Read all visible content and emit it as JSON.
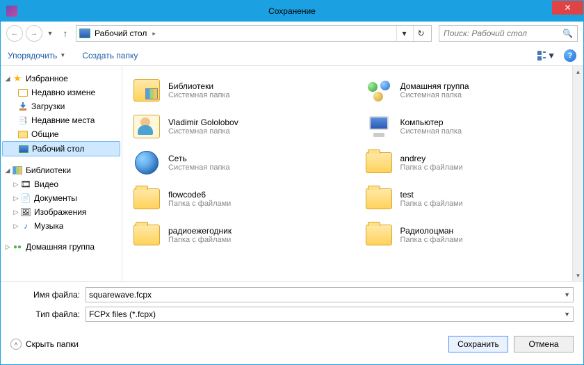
{
  "title": "Сохранение",
  "address": {
    "location": "Рабочий стол"
  },
  "search": {
    "placeholder": "Поиск: Рабочий стол"
  },
  "toolbar": {
    "organize": "Упорядочить",
    "newfolder": "Создать папку"
  },
  "sidebar": {
    "favorites": "Избранное",
    "recent": "Недавно измене",
    "downloads": "Загрузки",
    "recent_places": "Недавние места",
    "public": "Общие",
    "desktop": "Рабочий стол",
    "libraries": "Библиотеки",
    "video": "Видео",
    "documents": "Документы",
    "pictures": "Изображения",
    "music": "Музыка",
    "homegroup": "Домашняя группа"
  },
  "desc": {
    "system_folder": "Системная папка",
    "file_folder": "Папка с файлами"
  },
  "files": {
    "libraries": "Библиотеки",
    "homegroup": "Домашняя группа",
    "user": "Vladimir Gololobov",
    "computer": "Компьютер",
    "network": "Сеть",
    "andrey": "andrey",
    "flowcode": "flowcode6",
    "test": "test",
    "radio_year": "радиоежегодник",
    "radiolocman": "Радиолоцман"
  },
  "form": {
    "filename_label": "Имя файла:",
    "filetype_label": "Тип файла:",
    "filename_value": "squarewave.fcpx",
    "filetype_value": "FCPx files (*.fcpx)"
  },
  "buttons": {
    "hide_folders": "Скрыть папки",
    "save": "Сохранить",
    "cancel": "Отмена"
  }
}
